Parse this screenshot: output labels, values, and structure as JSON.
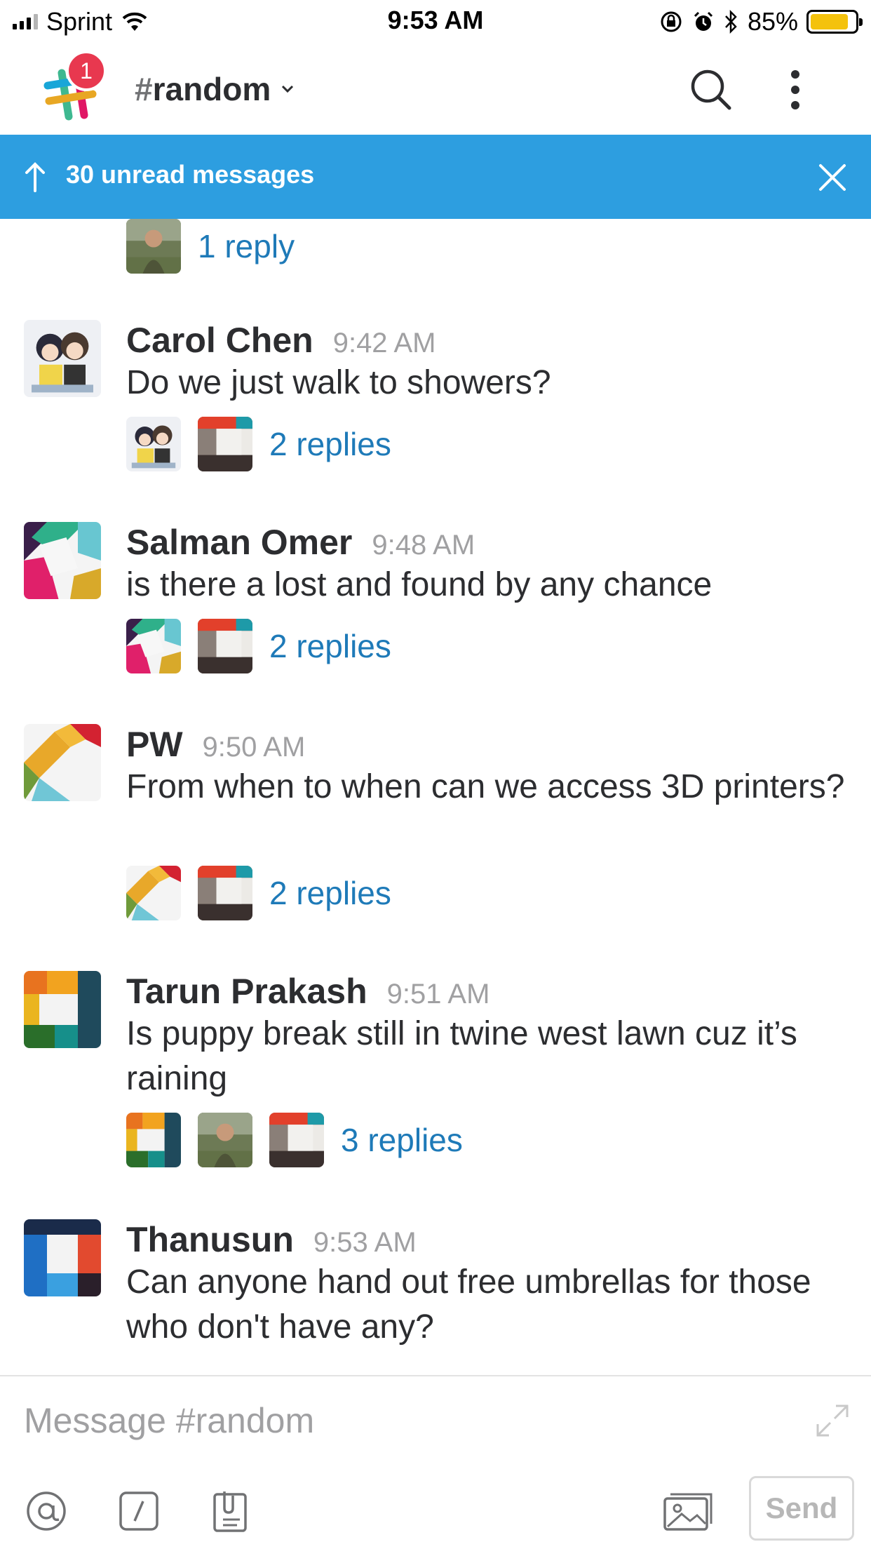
{
  "status_bar": {
    "carrier": "Sprint",
    "time": "9:53 AM",
    "battery": "85%",
    "battery_level": 0.85
  },
  "header": {
    "notification_count": "1",
    "channel_hash": "#",
    "channel_name": "random"
  },
  "unread_banner": {
    "text": "30 unread messages"
  },
  "top_thread": {
    "replies": "1 reply"
  },
  "messages": [
    {
      "name": "Carol Chen",
      "time": "9:42 AM",
      "text": "Do we just walk to showers?",
      "replies": "2 replies"
    },
    {
      "name": "Salman Omer",
      "time": "9:48 AM",
      "text": "is there a lost and found by any chance",
      "replies": "2 replies"
    },
    {
      "name": "PW",
      "time": "9:50 AM",
      "text": "From when to when can we access 3D printers?",
      "replies": "2 replies"
    },
    {
      "name": "Tarun Prakash",
      "time": "9:51 AM",
      "text": "Is puppy break still in twine west lawn cuz it’s raining",
      "replies": "3 replies"
    },
    {
      "name": "Thanusun",
      "time": "9:53 AM",
      "text": "Can anyone hand out free umbrellas for those who don't have any?"
    }
  ],
  "composer": {
    "placeholder": "Message #random",
    "send_label": "Send"
  },
  "colors": {
    "accent": "#2d9ee0",
    "link": "#1e7ab8",
    "badge": "#e8384f"
  }
}
